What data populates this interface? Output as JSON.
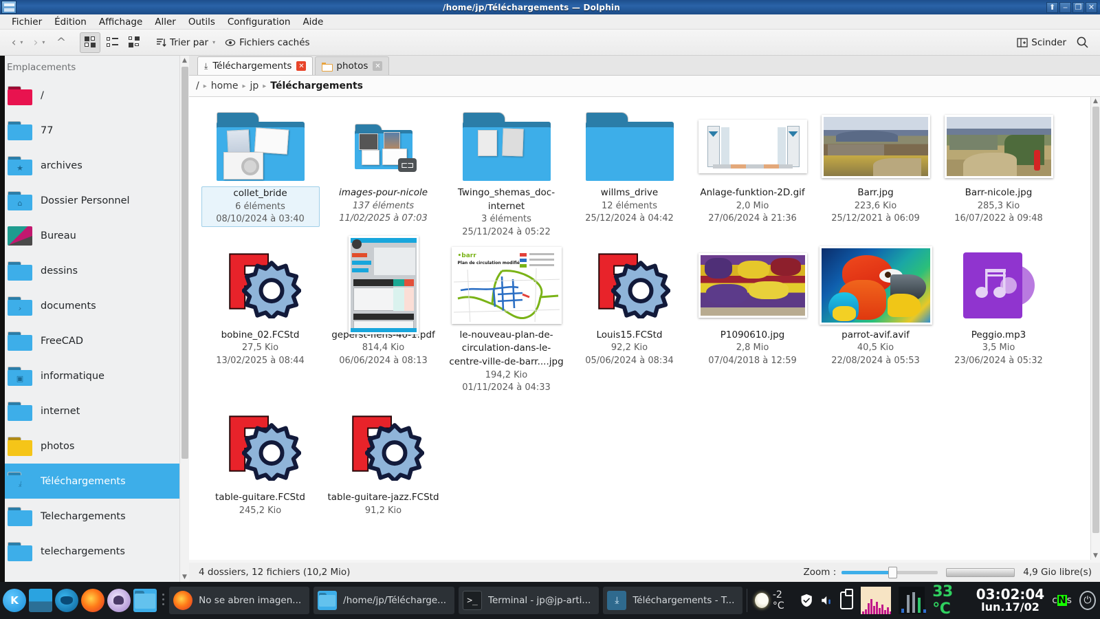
{
  "window": {
    "title": "/home/jp/Téléchargements — Dolphin",
    "buttons": {
      "keep_above": "⬆",
      "minimize": "‒",
      "maximize": "❐",
      "close": "✕"
    }
  },
  "menubar": {
    "items": [
      {
        "label": "Fichier"
      },
      {
        "label": "Édition"
      },
      {
        "label": "Affichage"
      },
      {
        "label": "Aller"
      },
      {
        "label": "Outils"
      },
      {
        "label": "Configuration"
      },
      {
        "label": "Aide"
      }
    ]
  },
  "toolbar": {
    "back": "‹",
    "forward": "›",
    "up": "^",
    "view_icons": "icons-view-icon",
    "view_compact": "compact-view-icon",
    "view_details": "details-view-icon",
    "sort_label": "Trier par",
    "hidden_files_label": "Fichiers cachés",
    "split_label": "Scinder",
    "search_label": "search-icon"
  },
  "sidebar": {
    "title": "Emplacements",
    "items": [
      {
        "label": "/",
        "icon": "folder-red",
        "selected": false
      },
      {
        "label": "77",
        "icon": "folder-blue",
        "selected": false
      },
      {
        "label": "archives",
        "icon": "folder-star",
        "selected": false
      },
      {
        "label": "Dossier Personnel",
        "icon": "folder-home",
        "selected": false
      },
      {
        "label": "Bureau",
        "icon": "desktop-image",
        "selected": false
      },
      {
        "label": "dessins",
        "icon": "folder-blue",
        "selected": false
      },
      {
        "label": "documents",
        "icon": "folder-documents",
        "selected": false
      },
      {
        "label": "FreeCAD",
        "icon": "folder-blue",
        "selected": false
      },
      {
        "label": "informatique",
        "icon": "folder-computer",
        "selected": false
      },
      {
        "label": "internet",
        "icon": "folder-blue",
        "selected": false
      },
      {
        "label": "photos",
        "icon": "folder-yellow",
        "selected": false
      },
      {
        "label": "Téléchargements",
        "icon": "folder-download",
        "selected": true
      },
      {
        "label": "Telechargements",
        "icon": "folder-blue",
        "selected": false
      },
      {
        "label": "telechargements",
        "icon": "folder-blue",
        "selected": false
      }
    ]
  },
  "tabs": [
    {
      "label": "Téléchargements",
      "icon": "download-icon",
      "active": true,
      "close": "✕"
    },
    {
      "label": "photos",
      "icon": "folder-icon",
      "active": false,
      "close": "✕"
    }
  ],
  "breadcrumb": {
    "segments": [
      "/",
      "home",
      "jp",
      "Téléchargements"
    ],
    "separator": "▸"
  },
  "files": [
    {
      "name": "collet_bride",
      "meta1": "6 éléments",
      "meta2": "08/10/2024 à 03:40",
      "icon": "folder-with-photos",
      "selected": true,
      "italic": false
    },
    {
      "name": "images-pour-nicole",
      "meta1": "137 éléments",
      "meta2": "11/02/2025 à 07:03",
      "icon": "folder-symlink-with-photos",
      "selected": false,
      "italic": true
    },
    {
      "name": "Twingo_shemas_doc-internet",
      "meta1": "3 éléments",
      "meta2": "25/11/2024 à 05:22",
      "icon": "folder-with-photos",
      "selected": false,
      "italic": false
    },
    {
      "name": "willms_drive",
      "meta1": "12 éléments",
      "meta2": "25/12/2024 à 04:42",
      "icon": "folder-plain",
      "selected": false,
      "italic": false
    },
    {
      "name": "Anlage-funktion-2D.gif",
      "meta1": "2,0 Mio",
      "meta2": "27/06/2024 à 21:36",
      "icon": "image-diagram",
      "selected": false,
      "italic": false
    },
    {
      "name": "Barr.jpg",
      "meta1": "223,6 Kio",
      "meta2": "25/12/2021 à 06:09",
      "icon": "image-landscape",
      "selected": false,
      "italic": false
    },
    {
      "name": "Barr-nicole.jpg",
      "meta1": "285,3 Kio",
      "meta2": "16/07/2022 à 09:48",
      "icon": "image-landscape2",
      "selected": false,
      "italic": false
    },
    {
      "name": "bobine_02.FCStd",
      "meta1": "27,5 Kio",
      "meta2": "13/02/2025 à 08:44",
      "icon": "freecad-icon",
      "selected": false,
      "italic": false
    },
    {
      "name": "geperst-flens-40-1.pdf",
      "meta1": "814,4 Kio",
      "meta2": "06/06/2024 à 08:13",
      "icon": "pdf-datasheet",
      "selected": false,
      "italic": false
    },
    {
      "name": "le-nouveau-plan-de-circulation-dans-le-centre-ville-de-barr....jpg",
      "meta1": "194,2 Kio",
      "meta2": "01/11/2024 à 04:33",
      "icon": "image-map",
      "selected": false,
      "italic": false
    },
    {
      "name": "Louis15.FCStd",
      "meta1": "92,2 Kio",
      "meta2": "05/06/2024 à 08:34",
      "icon": "freecad-icon",
      "selected": false,
      "italic": false
    },
    {
      "name": "P1090610.jpg",
      "meta1": "2,8 Mio",
      "meta2": "07/04/2018 à 12:59",
      "icon": "image-flowers",
      "selected": false,
      "italic": false
    },
    {
      "name": "parrot-avif.avif",
      "meta1": "40,5 Kio",
      "meta2": "22/08/2024 à 05:53",
      "icon": "image-parrot",
      "selected": false,
      "italic": false
    },
    {
      "name": "Peggio.mp3",
      "meta1": "3,5 Mio",
      "meta2": "23/06/2024 à 05:32",
      "icon": "audio-icon",
      "selected": false,
      "italic": false
    },
    {
      "name": "table-guitare.FCStd",
      "meta1": "245,2 Kio",
      "meta2": "",
      "icon": "freecad-icon",
      "selected": false,
      "italic": false
    },
    {
      "name": "table-guitare-jazz.FCStd",
      "meta1": "91,2 Kio",
      "meta2": "",
      "icon": "freecad-icon",
      "selected": false,
      "italic": false
    }
  ],
  "statusbar": {
    "summary": "4 dossiers, 12 fichiers (10,2 Mio)",
    "zoom_label": "Zoom :",
    "free_space": "4,9 Gio libre(s)"
  },
  "taskbar": {
    "launchers": [
      "kde-menu-icon",
      "app-blue-icon",
      "thunderbird-icon",
      "firefox-icon",
      "falkon-icon",
      "dolphin-folder-icon"
    ],
    "tasks": [
      {
        "label": "No se abren imagen...",
        "icon": "firefox-icon"
      },
      {
        "label": "/home/jp/Télécharge...",
        "icon": "dolphin-folder-icon"
      },
      {
        "label": "Terminal - jp@jp-arti...",
        "icon": "terminal-icon"
      },
      {
        "label": "Téléchargements - T...",
        "icon": "dolphin-download-icon"
      }
    ],
    "tray": {
      "weather_temp": "-2 °C",
      "weather_icon": "moon-icon",
      "shield_icon": "shield-icon",
      "volume_icon": "speaker-icon",
      "clipboard_icon": "clipboard-icon",
      "network_graph": "network-graph",
      "cpu_graph": "cpu-graph",
      "cpu_temp": "33 °C",
      "clock_time": "03:02:04",
      "clock_date": "lun.17/02",
      "keyboard_layout_prefix": "c",
      "keyboard_layout_hl": "N",
      "keyboard_layout_suffix": "s",
      "logout_icon": "logout-icon"
    }
  }
}
